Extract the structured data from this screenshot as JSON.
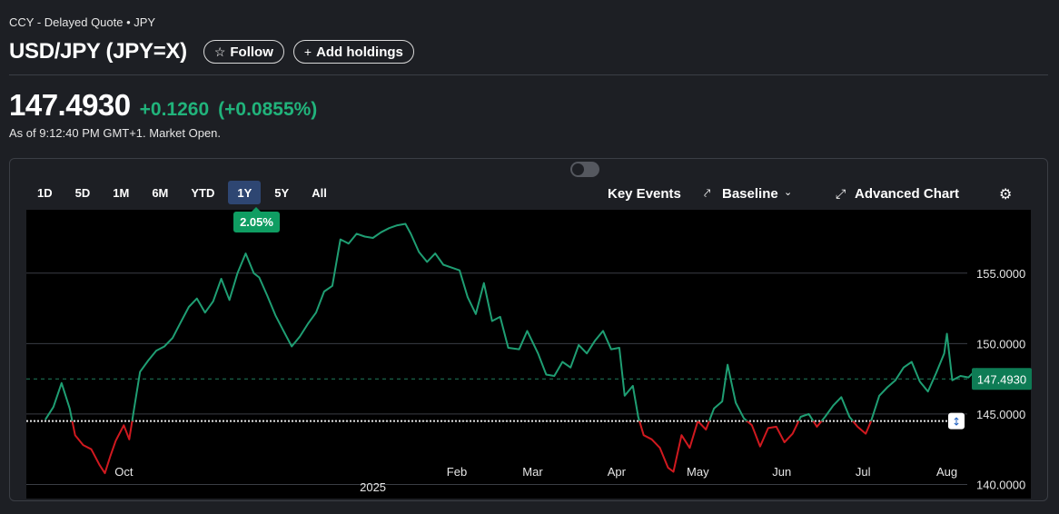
{
  "header": {
    "breadcrumb": "CCY - Delayed Quote • JPY",
    "title": "USD/JPY (JPY=X)",
    "follow_label": "Follow",
    "add_holdings_label": "Add holdings"
  },
  "quote": {
    "price": "147.4930",
    "change": "+0.1260",
    "change_percent": "(+0.0855%)",
    "as_of": "As of 9:12:40 PM GMT+1. Market Open.",
    "up_color": "#21b37b"
  },
  "chart_toolbar": {
    "ranges": [
      "1D",
      "5D",
      "1M",
      "6M",
      "YTD",
      "1Y",
      "5Y",
      "All"
    ],
    "active_range": "1Y",
    "key_events_label": "Key Events",
    "key_events_on": false,
    "baseline_label": "Baseline",
    "advanced_chart_label": "Advanced Chart",
    "icons": [
      "toggle-switch",
      "baseline-icon",
      "chevron-down-icon",
      "expand-icon",
      "gear-icon"
    ]
  },
  "chart_data": {
    "type": "line",
    "style": "baseline",
    "range_badge": "2.05%",
    "current_price_label": "147.4930",
    "baseline_value": 144.5,
    "current_value": 147.493,
    "ylim": [
      139,
      159.5
    ],
    "y_ticks": [
      {
        "value": 155,
        "label": "155.0000"
      },
      {
        "value": 150,
        "label": "150.0000"
      },
      {
        "value": 145,
        "label": "145.0000"
      },
      {
        "value": 140,
        "label": "140.0000"
      }
    ],
    "x_ticks": [
      {
        "date": "2024-10-01",
        "label": "Oct"
      },
      {
        "date": "2025-01-01",
        "label": "2025"
      },
      {
        "date": "2025-02-01",
        "label": "Feb"
      },
      {
        "date": "2025-03-01",
        "label": "Mar"
      },
      {
        "date": "2025-04-01",
        "label": "Apr"
      },
      {
        "date": "2025-05-01",
        "label": "May"
      },
      {
        "date": "2025-06-01",
        "label": "Jun"
      },
      {
        "date": "2025-07-01",
        "label": "Jul"
      },
      {
        "date": "2025-08-01",
        "label": "Aug"
      }
    ],
    "grid": true,
    "above_color": "#1f9e73",
    "below_color": "#d0191f",
    "series": [
      {
        "points": [
          [
            "2024-09-02",
            144.6
          ],
          [
            "2024-09-05",
            145.5
          ],
          [
            "2024-09-08",
            147.2
          ],
          [
            "2024-09-11",
            145.4
          ],
          [
            "2024-09-13",
            143.5
          ],
          [
            "2024-09-16",
            142.8
          ],
          [
            "2024-09-19",
            142.5
          ],
          [
            "2024-09-22",
            141.4
          ],
          [
            "2024-09-24",
            140.8
          ],
          [
            "2024-09-26",
            142.0
          ],
          [
            "2024-09-28",
            143.1
          ],
          [
            "2024-10-01",
            144.2
          ],
          [
            "2024-10-03",
            143.2
          ],
          [
            "2024-10-05",
            145.6
          ],
          [
            "2024-10-07",
            148.0
          ],
          [
            "2024-10-10",
            148.8
          ],
          [
            "2024-10-13",
            149.5
          ],
          [
            "2024-10-16",
            149.8
          ],
          [
            "2024-10-19",
            150.4
          ],
          [
            "2024-10-22",
            151.5
          ],
          [
            "2024-10-25",
            152.6
          ],
          [
            "2024-10-28",
            153.2
          ],
          [
            "2024-10-31",
            152.2
          ],
          [
            "2024-11-03",
            153.0
          ],
          [
            "2024-11-06",
            154.6
          ],
          [
            "2024-11-09",
            153.1
          ],
          [
            "2024-11-12",
            155.0
          ],
          [
            "2024-11-15",
            156.4
          ],
          [
            "2024-11-18",
            155.0
          ],
          [
            "2024-11-20",
            154.7
          ],
          [
            "2024-11-23",
            153.4
          ],
          [
            "2024-11-26",
            152.0
          ],
          [
            "2024-11-29",
            150.9
          ],
          [
            "2024-12-02",
            149.8
          ],
          [
            "2024-12-05",
            150.5
          ],
          [
            "2024-12-08",
            151.4
          ],
          [
            "2024-12-11",
            152.2
          ],
          [
            "2024-12-14",
            153.7
          ],
          [
            "2024-12-17",
            154.1
          ],
          [
            "2024-12-20",
            157.4
          ],
          [
            "2024-12-23",
            157.1
          ],
          [
            "2024-12-26",
            157.8
          ],
          [
            "2024-12-29",
            157.6
          ],
          [
            "2025-01-01",
            157.5
          ],
          [
            "2025-01-04",
            157.9
          ],
          [
            "2025-01-07",
            158.2
          ],
          [
            "2025-01-10",
            158.4
          ],
          [
            "2025-01-13",
            158.5
          ],
          [
            "2025-01-15",
            157.8
          ],
          [
            "2025-01-18",
            156.5
          ],
          [
            "2025-01-21",
            155.8
          ],
          [
            "2025-01-24",
            156.4
          ],
          [
            "2025-01-27",
            155.6
          ],
          [
            "2025-01-30",
            155.4
          ],
          [
            "2025-02-02",
            155.2
          ],
          [
            "2025-02-05",
            153.3
          ],
          [
            "2025-02-08",
            152.1
          ],
          [
            "2025-02-11",
            154.3
          ],
          [
            "2025-02-14",
            151.6
          ],
          [
            "2025-02-17",
            151.9
          ],
          [
            "2025-02-20",
            149.7
          ],
          [
            "2025-02-24",
            149.6
          ],
          [
            "2025-02-27",
            150.9
          ],
          [
            "2025-03-03",
            149.3
          ],
          [
            "2025-03-06",
            147.8
          ],
          [
            "2025-03-09",
            147.7
          ],
          [
            "2025-03-12",
            148.7
          ],
          [
            "2025-03-15",
            148.3
          ],
          [
            "2025-03-18",
            149.9
          ],
          [
            "2025-03-21",
            149.3
          ],
          [
            "2025-03-24",
            150.2
          ],
          [
            "2025-03-27",
            150.9
          ],
          [
            "2025-03-30",
            149.6
          ],
          [
            "2025-04-02",
            149.7
          ],
          [
            "2025-04-04",
            146.3
          ],
          [
            "2025-04-07",
            147.0
          ],
          [
            "2025-04-09",
            144.8
          ],
          [
            "2025-04-11",
            143.5
          ],
          [
            "2025-04-14",
            143.2
          ],
          [
            "2025-04-17",
            142.6
          ],
          [
            "2025-04-20",
            141.2
          ],
          [
            "2025-04-22",
            140.9
          ],
          [
            "2025-04-25",
            143.5
          ],
          [
            "2025-04-28",
            142.6
          ],
          [
            "2025-05-01",
            144.5
          ],
          [
            "2025-05-04",
            143.9
          ],
          [
            "2025-05-07",
            145.4
          ],
          [
            "2025-05-10",
            145.9
          ],
          [
            "2025-05-12",
            148.5
          ],
          [
            "2025-05-15",
            145.8
          ],
          [
            "2025-05-18",
            144.7
          ],
          [
            "2025-05-21",
            144.2
          ],
          [
            "2025-05-24",
            142.7
          ],
          [
            "2025-05-27",
            144.0
          ],
          [
            "2025-05-30",
            144.1
          ],
          [
            "2025-06-02",
            143.0
          ],
          [
            "2025-06-05",
            143.6
          ],
          [
            "2025-06-08",
            144.8
          ],
          [
            "2025-06-11",
            145.0
          ],
          [
            "2025-06-14",
            144.1
          ],
          [
            "2025-06-17",
            144.8
          ],
          [
            "2025-06-20",
            145.6
          ],
          [
            "2025-06-23",
            146.2
          ],
          [
            "2025-06-26",
            144.8
          ],
          [
            "2025-06-29",
            144.1
          ],
          [
            "2025-07-02",
            143.6
          ],
          [
            "2025-07-04",
            144.5
          ],
          [
            "2025-07-07",
            146.3
          ],
          [
            "2025-07-10",
            146.9
          ],
          [
            "2025-07-13",
            147.4
          ],
          [
            "2025-07-16",
            148.3
          ],
          [
            "2025-07-19",
            148.7
          ],
          [
            "2025-07-22",
            147.3
          ],
          [
            "2025-07-25",
            146.6
          ],
          [
            "2025-07-28",
            147.9
          ],
          [
            "2025-07-31",
            149.3
          ],
          [
            "2025-08-01",
            150.7
          ],
          [
            "2025-08-03",
            147.4
          ],
          [
            "2025-08-06",
            147.7
          ],
          [
            "2025-08-09",
            147.6
          ],
          [
            "2025-08-12",
            148.2
          ],
          [
            "2025-08-15",
            146.9
          ],
          [
            "2025-08-18",
            147.6
          ],
          [
            "2025-08-21",
            147.9
          ],
          [
            "2025-08-24",
            147.0
          ],
          [
            "2025-08-26",
            147.493
          ]
        ]
      }
    ]
  }
}
